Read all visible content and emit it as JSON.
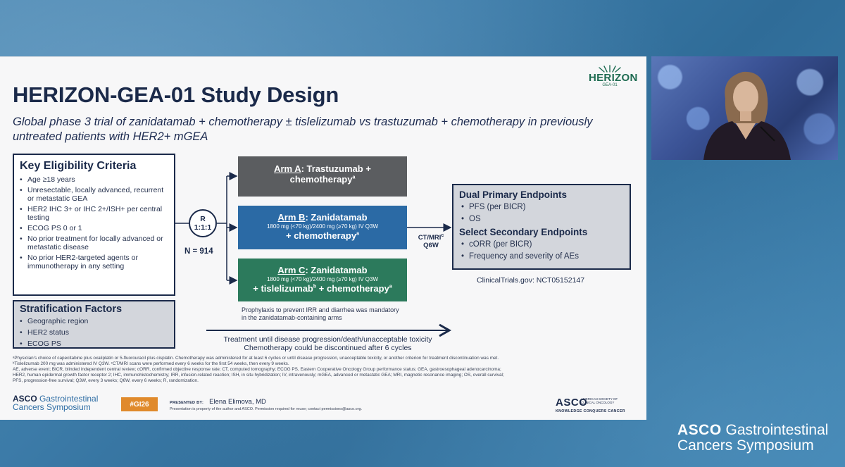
{
  "slide": {
    "logo": {
      "word": "HERIZON",
      "sub": "GEA-01"
    },
    "title": "HERIZON-GEA-01 Study Design",
    "subtitle": "Global phase 3 trial of zanidatamab + chemotherapy ± tislelizumab vs trastuzumab + chemotherapy in previously untreated patients with HER2+ mGEA",
    "eligibility": {
      "heading": "Key Eligibility Criteria",
      "items": [
        "Age ≥18 years",
        "Unresectable, locally advanced, recurrent or metastatic GEA",
        "HER2 IHC 3+ or IHC 2+/ISH+ per central testing",
        "ECOG PS 0 or 1",
        "No prior treatment for locally advanced or metastatic disease",
        "No prior HER2-targeted agents or immunotherapy in any setting"
      ]
    },
    "stratification": {
      "heading": "Stratification Factors",
      "items": [
        "Geographic region",
        "HER2 status",
        "ECOG PS"
      ]
    },
    "randomization": {
      "letter": "R",
      "ratio": "1:1:1",
      "n": "N = 914"
    },
    "arms": {
      "a": {
        "name": "Arm A",
        "drug": ": Trastuzumab +",
        "line2": "chemotherapy",
        "sup2": "a"
      },
      "b": {
        "name": "Arm B",
        "drug": ": Zanidatamab",
        "dose": "1800 mg (<70 kg)/2400 mg (≥70 kg) IV Q3W",
        "line2": "+ chemotherapy",
        "sup2": "a"
      },
      "c": {
        "name": "Arm C",
        "drug": ": Zanidatamab",
        "dose": "1800 mg (<70 kg)/2400 mg (≥70 kg) IV Q3W",
        "line2a": "+ tislelizumab",
        "sup2a": "b",
        "line2b": " + chemotherapy",
        "sup2b": "a"
      }
    },
    "prophylaxis": "Prophylaxis to prevent IRR and diarrhea was mandatory in the zanidatamab-containing arms",
    "imaging": {
      "label": "CT/MRI",
      "sup": "c",
      "freq": "Q6W"
    },
    "endpoints": {
      "primary_heading": "Dual Primary Endpoints",
      "primary": [
        "PFS (per BICR)",
        "OS"
      ],
      "secondary_heading": "Select Secondary Endpoints",
      "secondary": [
        "cORR (per BICR)",
        "Frequency and severity of AEs"
      ]
    },
    "ctgov": "ClinicalTrials.gov: NCT05152147",
    "treatment_note": {
      "line1": "Treatment until disease progression/death/unacceptable toxicity",
      "line2": "Chemotherapy could be discontinued after 6 cycles"
    },
    "footnotes": [
      "ᵃPhysician's choice of capecitabine plus oxaliplatin or 5-fluorouracil plus cisplatin. Chemotherapy was administered for at least 6 cycles or until disease progression, unacceptable toxicity, or another criterion for treatment discontinuation was met.",
      "ᵇTislelizumab 200 mg was administered IV Q3W. ᶜCT/MRI scans were performed every 6 weeks for the first 54 weeks, then every 9 weeks.",
      "AE, adverse event; BICR, blinded independent central review; cORR, confirmed objective response rate; CT, computed tomography; ECOG PS, Eastern Cooperative Oncology Group performance status; GEA, gastroesophageal adenocarcinoma;",
      "HER2, human epidermal growth factor receptor 2; IHC, immunohistochemistry; IRR, infusion-related reaction; ISH, in situ hybridization; IV, intravenously; mGEA, advanced or metastatic GEA; MRI, magnetic resonance imaging; OS, overall survival;",
      "PFS, progression-free survival; Q3W, every 3 weeks; Q6W, every 6 weeks; R, randomization."
    ],
    "footer": {
      "asco": "ASCO",
      "gi_line1": "Gastrointestinal",
      "gi_line2": "Cancers Symposium",
      "badge": "#GI26",
      "presented_label": "PRESENTED BY:",
      "presenter": "Elena Elimova, MD",
      "copyright": "Presentation is property of the author and ASCO. Permission required for reuse; contact permissions@asco.org.",
      "right_logo": "ASCO",
      "right_small": "AMERICAN SOCIETY OF CLINICAL ONCOLOGY",
      "right_tag": "KNOWLEDGE CONQUERS CANCER"
    }
  },
  "watermark": {
    "asco": "ASCO",
    "line1": "Gastrointestinal",
    "line2": "Cancers Symposium"
  },
  "colors": {
    "arm_a": "#5b5d60",
    "arm_b": "#2b6aa5",
    "arm_c": "#2c7a5c",
    "navy": "#1b2a4a",
    "badge": "#e08a2c",
    "herizon_green": "#1e6b51"
  }
}
